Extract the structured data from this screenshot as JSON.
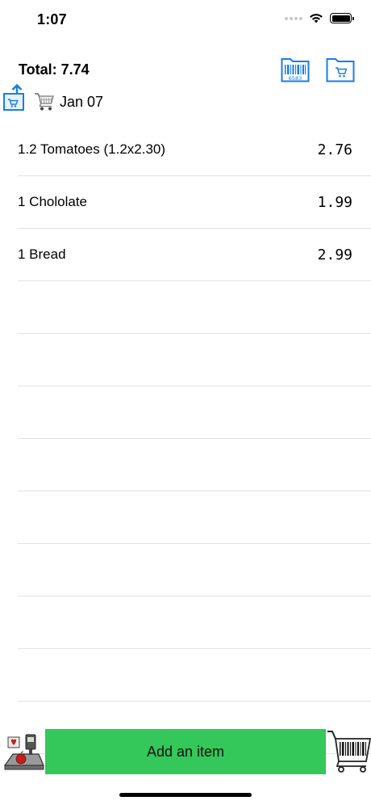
{
  "status_bar": {
    "time": "1:07"
  },
  "header": {
    "total_label": "Total: 7.74",
    "list_date": "Jan 07",
    "folder_barcode_number": "6583"
  },
  "items": [
    {
      "name": "1.2 Tomatoes (1.2x2.30)",
      "price": "2.76"
    },
    {
      "name": "1 Chololate",
      "price": "1.99"
    },
    {
      "name": "1 Bread",
      "price": "2.99"
    },
    {
      "name": "",
      "price": ""
    },
    {
      "name": "",
      "price": ""
    },
    {
      "name": "",
      "price": ""
    },
    {
      "name": "",
      "price": ""
    },
    {
      "name": "",
      "price": ""
    },
    {
      "name": "",
      "price": ""
    },
    {
      "name": "",
      "price": ""
    },
    {
      "name": "",
      "price": ""
    },
    {
      "name": "",
      "price": ""
    }
  ],
  "footer": {
    "add_item_label": "Add an item"
  },
  "icons": {
    "folder_barcode": "folder-barcode-icon",
    "folder_cart": "folder-cart-icon",
    "share": "share-icon",
    "cart": "shopping-cart-icon",
    "scale": "scale-icon",
    "cart_barcode": "cart-barcode-icon"
  },
  "colors": {
    "accent_blue": "#1a7ee0",
    "add_button_green": "#34c759",
    "separator": "#e3e3e6"
  }
}
